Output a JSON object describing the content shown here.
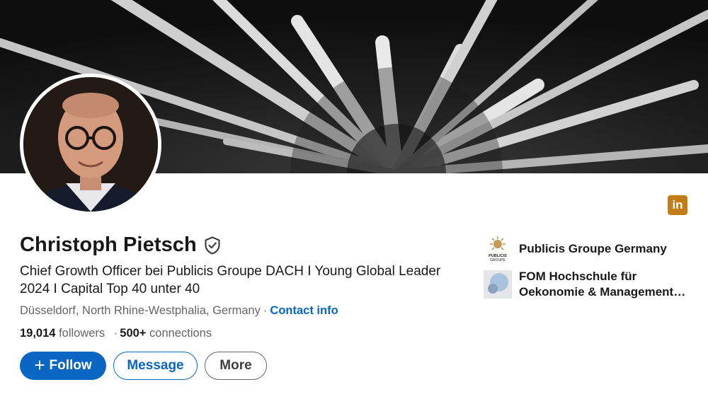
{
  "profile": {
    "name": "Christoph Pietsch",
    "headline": "Chief Growth Officer bei Publicis Groupe DACH I Young Global Leader 2024 I Capital Top 40 unter 40",
    "location": "Düsseldorf, North Rhine-Westphalia, Germany",
    "location_separator": "·",
    "contact_label": "Contact info",
    "followers_count": "19,014",
    "followers_label": "followers",
    "stats_separator": "·",
    "connections_count": "500+",
    "connections_label": "connections"
  },
  "actions": {
    "follow_label": "Follow",
    "follow_icon": "plus-icon",
    "message_label": "Message",
    "more_label": "More"
  },
  "brand_badge": {
    "text": "in",
    "icon": "linkedin-icon",
    "color": "#c37d16"
  },
  "organizations": [
    {
      "name": "Publicis Groupe Germany",
      "logo_text_1": "PUBLICIS",
      "logo_text_2": "GROUPE"
    },
    {
      "name": "FOM Hochschule für Oekonomie & Management gemeinnützige GmbH"
    }
  ],
  "colors": {
    "primary": "#0a66c2",
    "text": "#191919",
    "muted": "#666666",
    "banner": "#1a1a1a"
  }
}
